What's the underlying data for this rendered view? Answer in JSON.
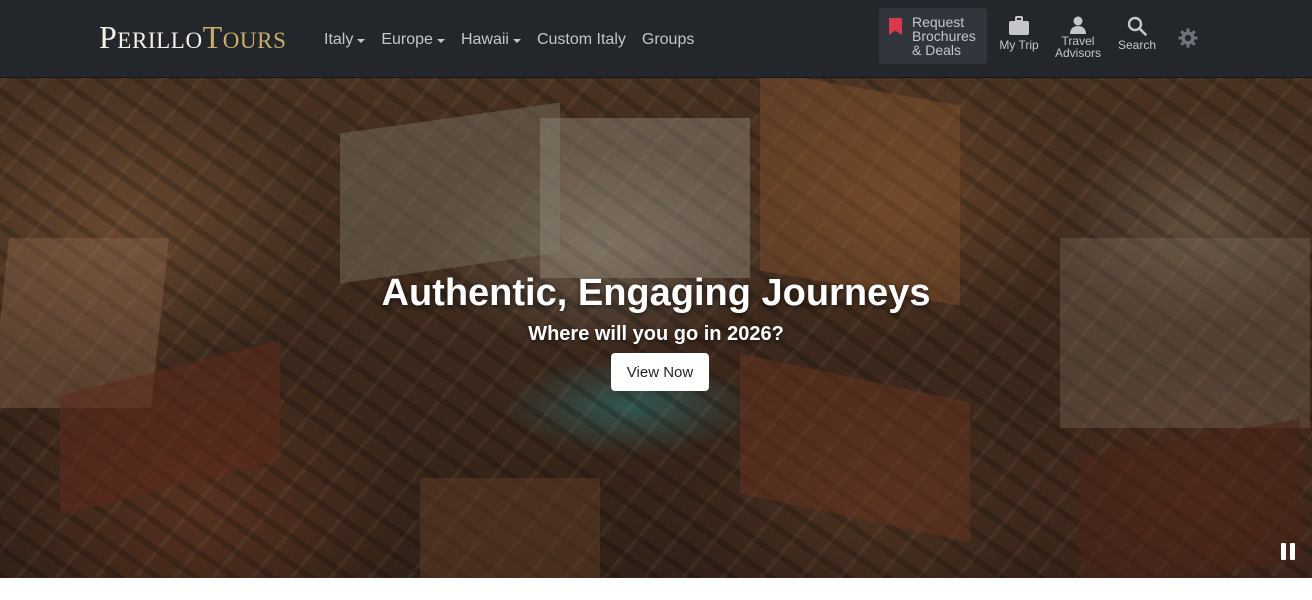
{
  "navbar": {
    "logo": {
      "part1": "P",
      "part2": "ERILLO",
      "part3": "T",
      "part4": "OURS"
    },
    "links": [
      {
        "label": "Italy",
        "has_dropdown": true
      },
      {
        "label": "Europe",
        "has_dropdown": true
      },
      {
        "label": "Hawaii",
        "has_dropdown": true
      },
      {
        "label": "Custom Italy",
        "has_dropdown": false
      },
      {
        "label": "Groups",
        "has_dropdown": false
      }
    ],
    "brochure": {
      "line1": "Request",
      "line2": "Brochures",
      "line3": "& Deals",
      "icon": "bookmark-icon",
      "icon_color": "#d8394c"
    },
    "utilities": {
      "my_trip": {
        "label": "My Trip",
        "icon": "suitcase-icon"
      },
      "advisors": {
        "line1": "Travel",
        "line2": "Advisors",
        "icon": "person-icon"
      },
      "search": {
        "label": "Search",
        "icon": "search-icon"
      }
    },
    "theme_toggle": {
      "icon": "gear-icon"
    }
  },
  "hero": {
    "title": "Authentic, Engaging Journeys",
    "subtitle": "Where will you go in 2026?",
    "cta": "View Now",
    "pause_icon": "pause-icon"
  },
  "colors": {
    "nav_bg": "#23262b",
    "nav_text": "#c4c6ca",
    "logo_gold": "#c8ae6a",
    "button_bg": "#ffffff"
  }
}
